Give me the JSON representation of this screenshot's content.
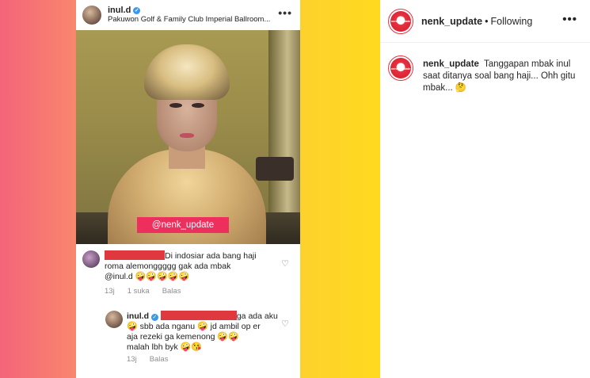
{
  "post": {
    "header": {
      "username": "inul.d",
      "location": "Pakuwon Golf & Family Club Imperial Ballroom...",
      "more": "•••"
    },
    "watermark": "@nenk_update",
    "comments": [
      {
        "text_line1": "Di indosiar ada bang haji",
        "text_line2": "roma alemonggggg gak ada mbak",
        "text_line3": "@inul.d",
        "emojis": "🤪🤪🤪🤪🤪",
        "time": "13j",
        "likes": "1 suka",
        "reply": "Balas"
      },
      {
        "username": "inul.d",
        "text_line1": "ga ada aku",
        "text_line2": "sbb ada nganu",
        "text_line2b": "jd ambil op er",
        "text_line3": "aja rezeki ga kemenong",
        "text_line4": "malah lbh byk",
        "time": "13j",
        "reply": "Balas"
      }
    ]
  },
  "panel": {
    "username": "nenk_update",
    "separator": "•",
    "follow_status": "Following",
    "more": "•••",
    "avatar_text": "nenk_update",
    "caption": {
      "username": "nenk_update",
      "text": "Tanggapan mbak inul saat ditanya soal bang haji... Ohh gitu mbak... 🤔"
    }
  },
  "colors": {
    "gradient_left": "#f4647a",
    "gradient_right": "#ffd91f",
    "watermark_bg": "#ee2f5e",
    "redaction": "#e0383f",
    "verified": "#3897f0"
  }
}
